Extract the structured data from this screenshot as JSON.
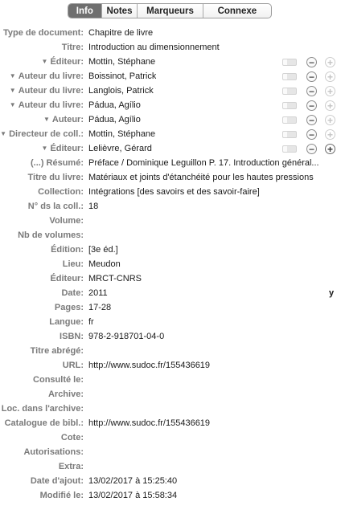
{
  "tabs": [
    {
      "label": "Info",
      "active": true
    },
    {
      "label": "Notes",
      "active": false
    },
    {
      "label": "Marqueurs",
      "active": false
    },
    {
      "label": "Connexe",
      "active": false
    }
  ],
  "fields": [
    {
      "label": "Type de document:",
      "value": "Chapitre de livre"
    },
    {
      "label": "Titre:",
      "value": "Introduction au dimensionnement"
    },
    {
      "label": "Éditeur:",
      "value": "Mottin, Stéphane",
      "creator": true,
      "plus_enabled": false
    },
    {
      "label": "Auteur du livre:",
      "value": "Boissinot, Patrick",
      "creator": true,
      "plus_enabled": false
    },
    {
      "label": "Auteur du livre:",
      "value": "Langlois, Patrick",
      "creator": true,
      "plus_enabled": false
    },
    {
      "label": "Auteur du livre:",
      "value": "Pádua, Agílio",
      "creator": true,
      "plus_enabled": false
    },
    {
      "label": "Auteur:",
      "value": "Pádua, Agílio",
      "creator": true,
      "plus_enabled": false
    },
    {
      "label": "Directeur de coll.:",
      "value": "Mottin, Stéphane",
      "creator": true,
      "plus_enabled": false
    },
    {
      "label": "Éditeur:",
      "value": "Lelièvre, Gérard",
      "creator": true,
      "plus_enabled": true
    },
    {
      "label": "(...) Résumé:",
      "value": "Préface / Dominique Leguillon  P. 17. Introduction général..."
    },
    {
      "label": "Titre du livre:",
      "value": "Matériaux et joints d'étanchéité pour les hautes pressions"
    },
    {
      "label": "Collection:",
      "value": "Intégrations [des savoirs et des savoir-faire]"
    },
    {
      "label": "N° ds la coll.:",
      "value": "18"
    },
    {
      "label": "Volume:",
      "value": ""
    },
    {
      "label": "Nb de volumes:",
      "value": ""
    },
    {
      "label": "Édition:",
      "value": "[3e éd.]"
    },
    {
      "label": "Lieu:",
      "value": "Meudon"
    },
    {
      "label": "Éditeur:",
      "value": "MRCT-CNRS"
    },
    {
      "label": "Date:",
      "value": "2011",
      "extra": "y"
    },
    {
      "label": "Pages:",
      "value": "17-28"
    },
    {
      "label": "Langue:",
      "value": "fr"
    },
    {
      "label": "ISBN:",
      "value": "978-2-918701-04-0"
    },
    {
      "label": "Titre abrégé:",
      "value": ""
    },
    {
      "label": "URL:",
      "value": "http://www.sudoc.fr/155436619"
    },
    {
      "label": "Consulté le:",
      "value": ""
    },
    {
      "label": "Archive:",
      "value": ""
    },
    {
      "label": "Loc. dans l'archive:",
      "value": ""
    },
    {
      "label": "Catalogue de bibl.:",
      "value": "http://www.sudoc.fr/155436619"
    },
    {
      "label": "Cote:",
      "value": ""
    },
    {
      "label": "Autorisations:",
      "value": ""
    },
    {
      "label": "Extra:",
      "value": ""
    },
    {
      "label": "Date d'ajout:",
      "value": "13/02/2017 à 15:25:40"
    },
    {
      "label": "Modifié le:",
      "value": "13/02/2017 à 15:58:34"
    }
  ],
  "glyphs": {
    "disclosure": "▼",
    "minus": "−",
    "plus": "+"
  }
}
